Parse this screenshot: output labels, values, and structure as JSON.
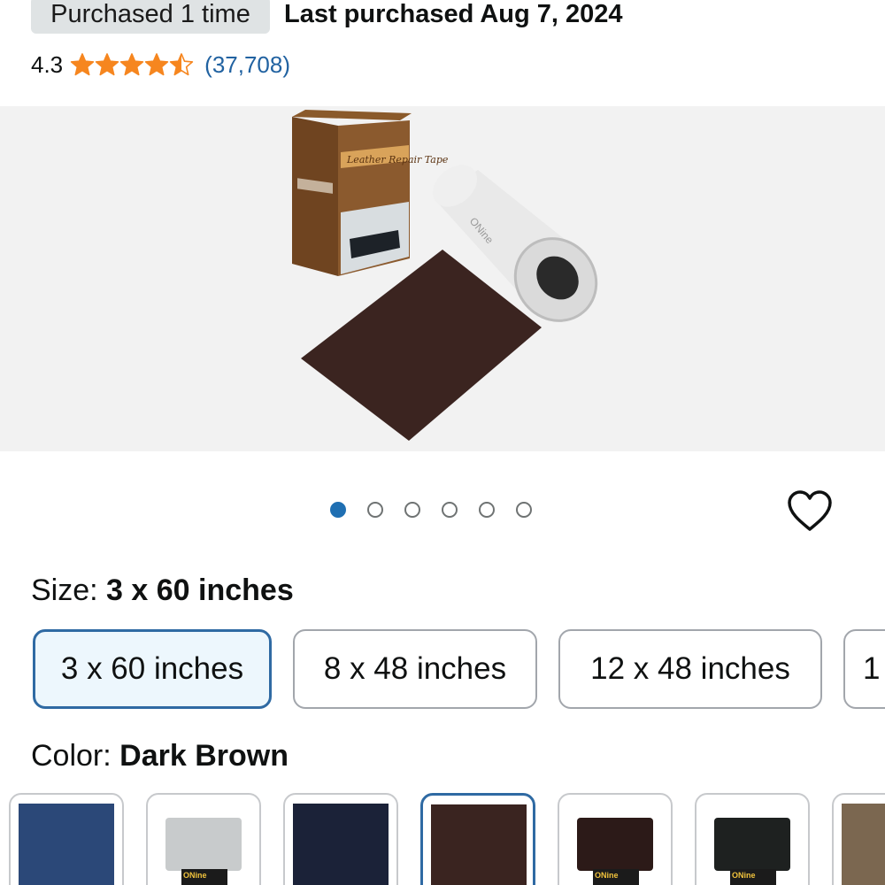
{
  "purchase": {
    "badge": "Purchased 1 time",
    "last_purchased": "Last purchased Aug 7, 2024"
  },
  "rating": {
    "value": "4.3",
    "stars": 4.5,
    "count": "(37,708)",
    "star_color": "#f6861f",
    "link_color": "#2162a1"
  },
  "product_image": {
    "box_text": "Leather Repair Tape",
    "roll_text": "ONine",
    "icon": "product-photo"
  },
  "carousel": {
    "total": 6,
    "active_index": 0,
    "active_color": "#1f6fb2"
  },
  "wishlist": {
    "icon": "heart-icon"
  },
  "size": {
    "label": "Size: ",
    "selected": "3 x 60 inches",
    "options": [
      {
        "label": "3 x 60 inches",
        "selected": true
      },
      {
        "label": "8 x 48 inches",
        "selected": false
      },
      {
        "label": "12 x 48 inches",
        "selected": false
      },
      {
        "label": "1",
        "selected": false
      }
    ]
  },
  "color": {
    "label": "Color: ",
    "selected": "Dark Brown",
    "swatches": [
      {
        "name": "navy-blue",
        "hex": "#2b4878",
        "style": "flat",
        "selected": false
      },
      {
        "name": "light-gray",
        "hex": "#c8cbcc",
        "style": "roll",
        "selected": false
      },
      {
        "name": "dark-navy",
        "hex": "#1b2238",
        "style": "flat",
        "selected": false
      },
      {
        "name": "dark-brown",
        "hex": "#3a2420",
        "style": "flat",
        "selected": true
      },
      {
        "name": "espresso",
        "hex": "#2c1a18",
        "style": "roll",
        "selected": false
      },
      {
        "name": "black",
        "hex": "#1e2120",
        "style": "roll",
        "selected": false
      },
      {
        "name": "taupe",
        "hex": "#7b6750",
        "style": "flat",
        "selected": false
      }
    ],
    "selected_border": "#2f6aa3"
  }
}
